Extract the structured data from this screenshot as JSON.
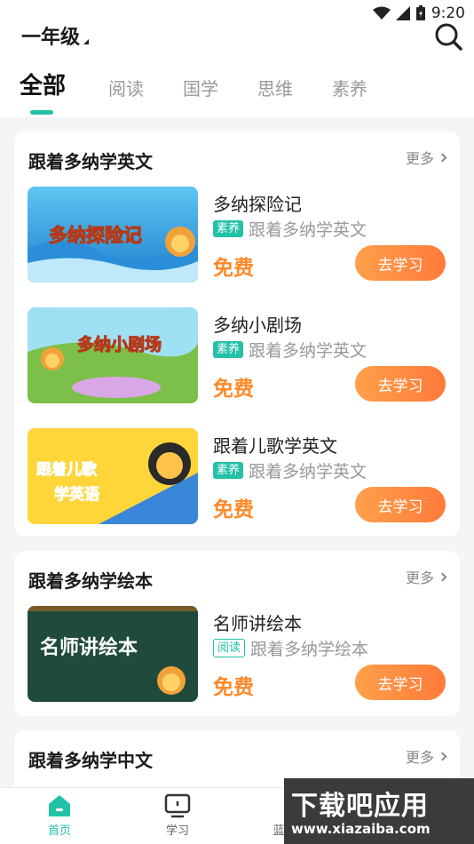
{
  "status": {
    "time": "9:20"
  },
  "header": {
    "grade": "一年级"
  },
  "tabs": [
    "全部",
    "阅读",
    "国学",
    "思维",
    "素养"
  ],
  "sections": [
    {
      "title": "跟着多纳学英文",
      "more": "更多",
      "courses": [
        {
          "name": "多纳探险记",
          "tag": "素养",
          "series": "跟着多纳学英文",
          "price": "免费",
          "action": "去学习",
          "banner": "多纳探险记"
        },
        {
          "name": "多纳小剧场",
          "tag": "素养",
          "series": "跟着多纳学英文",
          "price": "免费",
          "action": "去学习",
          "banner": "多纳小剧场"
        },
        {
          "name": "跟着儿歌学英文",
          "tag": "素养",
          "series": "跟着多纳学英文",
          "price": "免费",
          "action": "去学习",
          "banner": "跟着儿歌\n学英语"
        }
      ]
    },
    {
      "title": "跟着多纳学绘本",
      "more": "更多",
      "courses": [
        {
          "name": "名师讲绘本",
          "tag": "阅读",
          "series": "跟着多纳学绘本",
          "price": "免费",
          "action": "去学习",
          "banner": "名师讲绘本"
        }
      ]
    },
    {
      "title": "跟着多纳学中文",
      "more": "更多",
      "courses": []
    }
  ],
  "bottom_nav": [
    {
      "label": "首页",
      "icon": "home-icon"
    },
    {
      "label": "学习",
      "icon": "tv-icon"
    },
    {
      "label": "蓝",
      "icon": "partial-icon"
    }
  ],
  "watermark": {
    "title": "下载吧应用",
    "url": "www.xiazaiba.com"
  },
  "colors": {
    "accent": "#22c1a8",
    "price": "#ff8a2a",
    "button_start": "#ffa04a",
    "button_end": "#ff7a3a"
  }
}
